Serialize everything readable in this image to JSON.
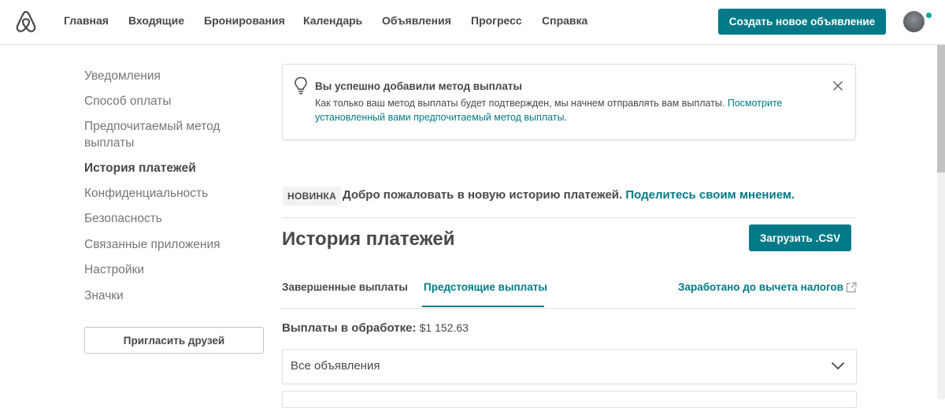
{
  "nav": {
    "items": [
      "Главная",
      "Входящие",
      "Бронирования",
      "Календарь",
      "Объявления",
      "Прогресс",
      "Справка"
    ],
    "create_listing": "Создать новое объявление"
  },
  "sidebar": {
    "items": [
      {
        "label": "Уведомления"
      },
      {
        "label": "Способ оплаты"
      },
      {
        "label": "Предпочитаемый метод"
      },
      {
        "label": "выплаты"
      },
      {
        "label": "История платежей",
        "active": true
      },
      {
        "label": "Конфиденциальность"
      },
      {
        "label": "Безопасность"
      },
      {
        "label": "Связанные приложения"
      },
      {
        "label": "Настройки"
      },
      {
        "label": "Значки"
      }
    ],
    "invite_button": "Пригласить друзей"
  },
  "alert": {
    "title": "Вы успешно добавили метод выплаты",
    "text": "Как только ваш метод выплаты будет подтвержден, мы начнем отправлять вам выплаты. ",
    "link": "Посмотрите установленный вами предпочитаемый метод выплаты",
    "period": "."
  },
  "banner": {
    "badge": "НОВИНКА",
    "text": "Добро пожаловать в новую историю платежей. ",
    "link": "Поделитесь своим мнением."
  },
  "main": {
    "title": "История платежей",
    "csv_button": "Загрузить .CSV",
    "tabs": [
      {
        "label": "Завершенные выплаты",
        "active": false
      },
      {
        "label": "Предстоящие выплаты",
        "active": true
      }
    ],
    "earned_link": "Заработано до вычета налогов",
    "processing_label": "Выплаты в обработке:",
    "processing_amount": "$1 152.63",
    "listing_filter": "Все объявления"
  },
  "colors": {
    "accent": "#007a87",
    "text": "#484848",
    "muted": "#767676",
    "brand_logo": "#484848",
    "badge_bg": "#f2f2f2"
  }
}
